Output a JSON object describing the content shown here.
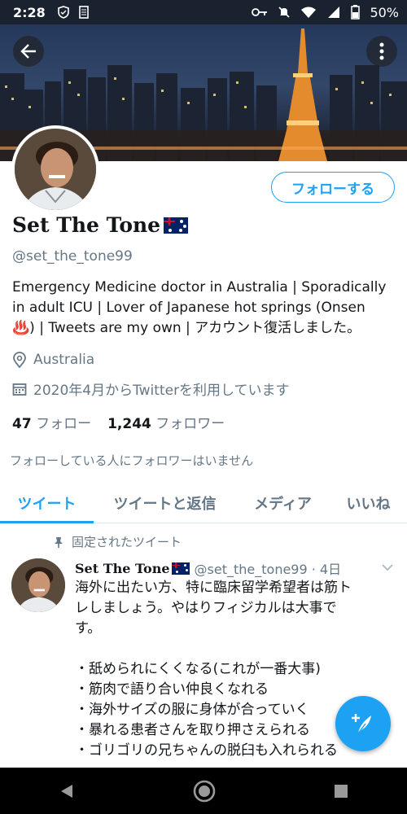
{
  "status_bar": {
    "time": "2:28",
    "battery": "50%"
  },
  "profile": {
    "name": "Set The Tone",
    "handle": "@set_the_tone99",
    "follow_button": "フォローする",
    "bio_lines": [
      "Emergency Medicine doctor in Australia | Sporadically",
      "in adult ICU | Lover of Japanese hot springs (Onsen",
      "♨️) | Tweets are my own | アカウント復活しました。"
    ],
    "location": "Australia",
    "joined": "2020年4月からTwitterを利用しています",
    "following_count": "47",
    "following_label": "フォロー",
    "followers_count": "1,244",
    "followers_label": "フォロワー",
    "followers_you_know": "フォローしている人にフォロワーはいません"
  },
  "tabs": [
    {
      "label": "ツイート",
      "active": true
    },
    {
      "label": "ツイートと返信",
      "active": false
    },
    {
      "label": "メディア",
      "active": false
    },
    {
      "label": "いいね",
      "active": false
    }
  ],
  "pinned_tweet": {
    "pinned_label": "固定されたツイート",
    "author_name": "Set The Tone",
    "meta": "@set_the_tone99 · 4日",
    "text_lines": [
      "海外に出たい方、特に臨床留学希望者は筋ト",
      "レしましょう。やはりフィジカルは大事で",
      "す。",
      "",
      "・舐められにくくなる(これが一番大事)",
      "・筋肉で語り合い仲良くなれる",
      "・海外サイズの服に身体が合っていく",
      "・暴れる患者さんを取り押さえられる",
      "・ゴリゴリの兄ちゃんの脱臼も入れられる"
    ]
  },
  "icons": {
    "back": "back-arrow-icon",
    "more": "more-vertical-icon",
    "location": "location-pin-icon",
    "calendar": "calendar-icon",
    "pin": "pin-icon",
    "chevron": "chevron-down-icon",
    "compose": "compose-tweet-icon"
  },
  "colors": {
    "accent": "#1da1f2",
    "secondary_text": "#657786",
    "text": "#14171a"
  }
}
